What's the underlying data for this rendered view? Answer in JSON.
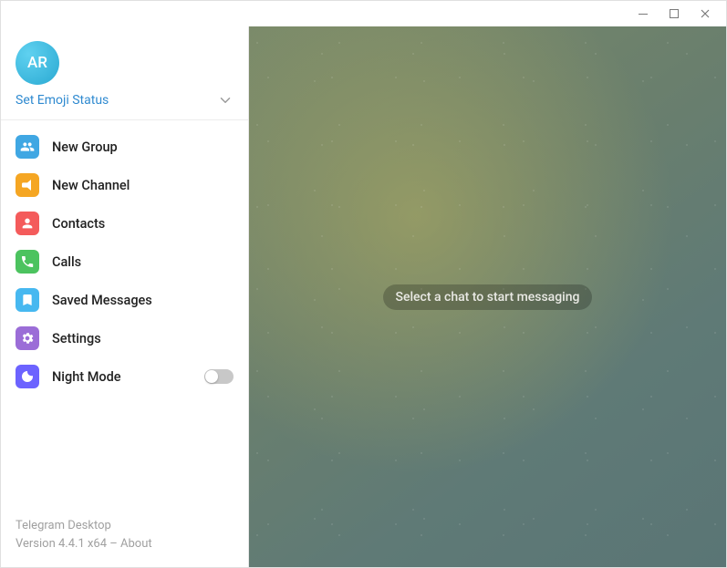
{
  "avatar_initials": "AR",
  "emoji_status_text": "Set Emoji Status",
  "menu": {
    "new_group": "New Group",
    "new_channel": "New Channel",
    "contacts": "Contacts",
    "calls": "Calls",
    "saved_messages": "Saved Messages",
    "settings": "Settings",
    "night_mode": "Night Mode"
  },
  "night_mode_on": false,
  "footer": {
    "app_name": "Telegram Desktop",
    "version_line": "Version 4.4.1 x64 – About"
  },
  "main_placeholder": "Select a chat to start messaging"
}
